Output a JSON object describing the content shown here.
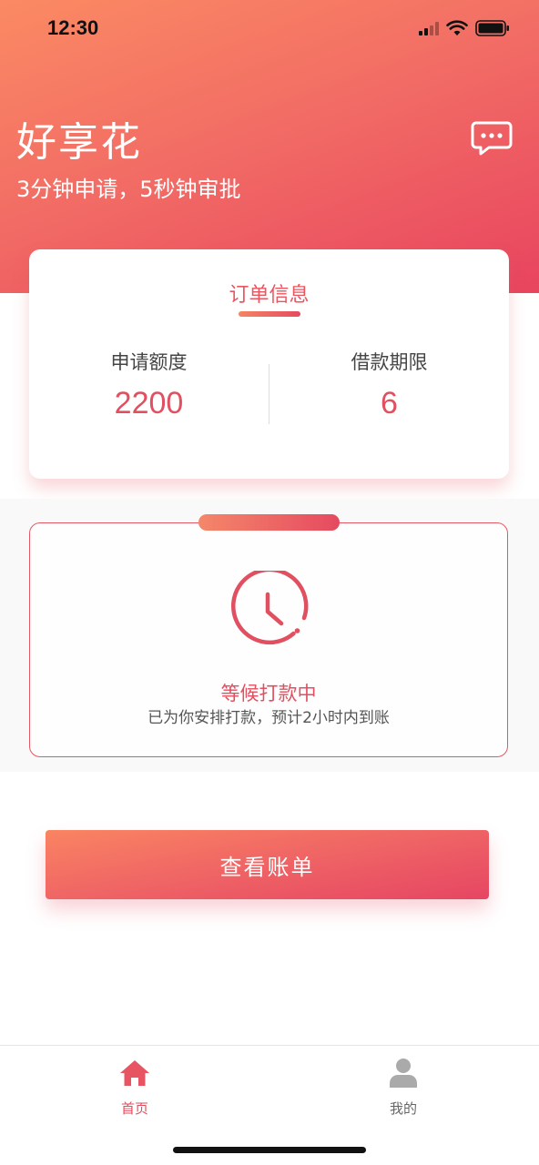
{
  "status_bar": {
    "time": "12:30",
    "icons": [
      "signal-icon",
      "wifi-icon",
      "battery-icon"
    ]
  },
  "header": {
    "title": "好享花",
    "subtitle": "3分钟申请，5秒钟审批",
    "message_icon": "chat-bubble-icon"
  },
  "order": {
    "title": "订单信息",
    "amount_label": "申请额度",
    "amount_value": "2200",
    "term_label": "借款期限",
    "term_value": "6"
  },
  "status": {
    "icon": "clock-icon",
    "title": "等候打款中",
    "description": "已为你安排打款，预计2小时内到账"
  },
  "actions": {
    "view_bill": "查看账单"
  },
  "tabbar": {
    "items": [
      {
        "label": "首页",
        "icon": "home-icon",
        "active": true
      },
      {
        "label": "我的",
        "icon": "user-icon",
        "active": false
      }
    ]
  },
  "colors": {
    "accent": "#e8505f",
    "gradient_start": "#fb8a63",
    "gradient_end": "#e8445f"
  }
}
